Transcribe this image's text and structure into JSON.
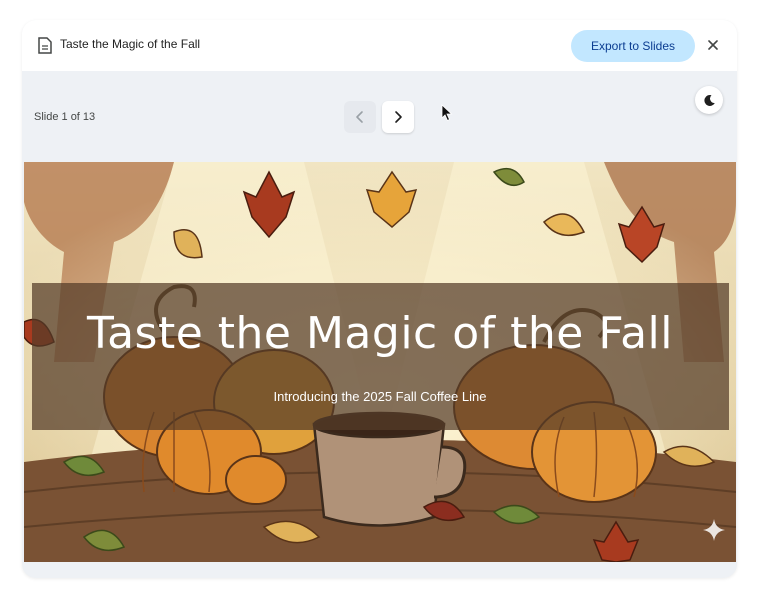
{
  "header": {
    "doc_icon": "document-icon",
    "title": "Taste the Magic of the Fall",
    "export_label": "Export to Slides",
    "close_icon": "close-icon"
  },
  "toolbar": {
    "slide_counter": "Slide 1 of 13",
    "prev_icon": "chevron-left-icon",
    "next_icon": "chevron-right-icon",
    "theme_icon": "moon-icon"
  },
  "slide": {
    "title": "Taste the Magic of the Fall",
    "subtitle": "Introducing the 2025 Fall Coffee Line",
    "watermark_icon": "sparkle-icon"
  },
  "colors": {
    "export_bg": "#c2e7ff",
    "panel_bg": "#eef1f5",
    "title_band": "#553c28"
  }
}
